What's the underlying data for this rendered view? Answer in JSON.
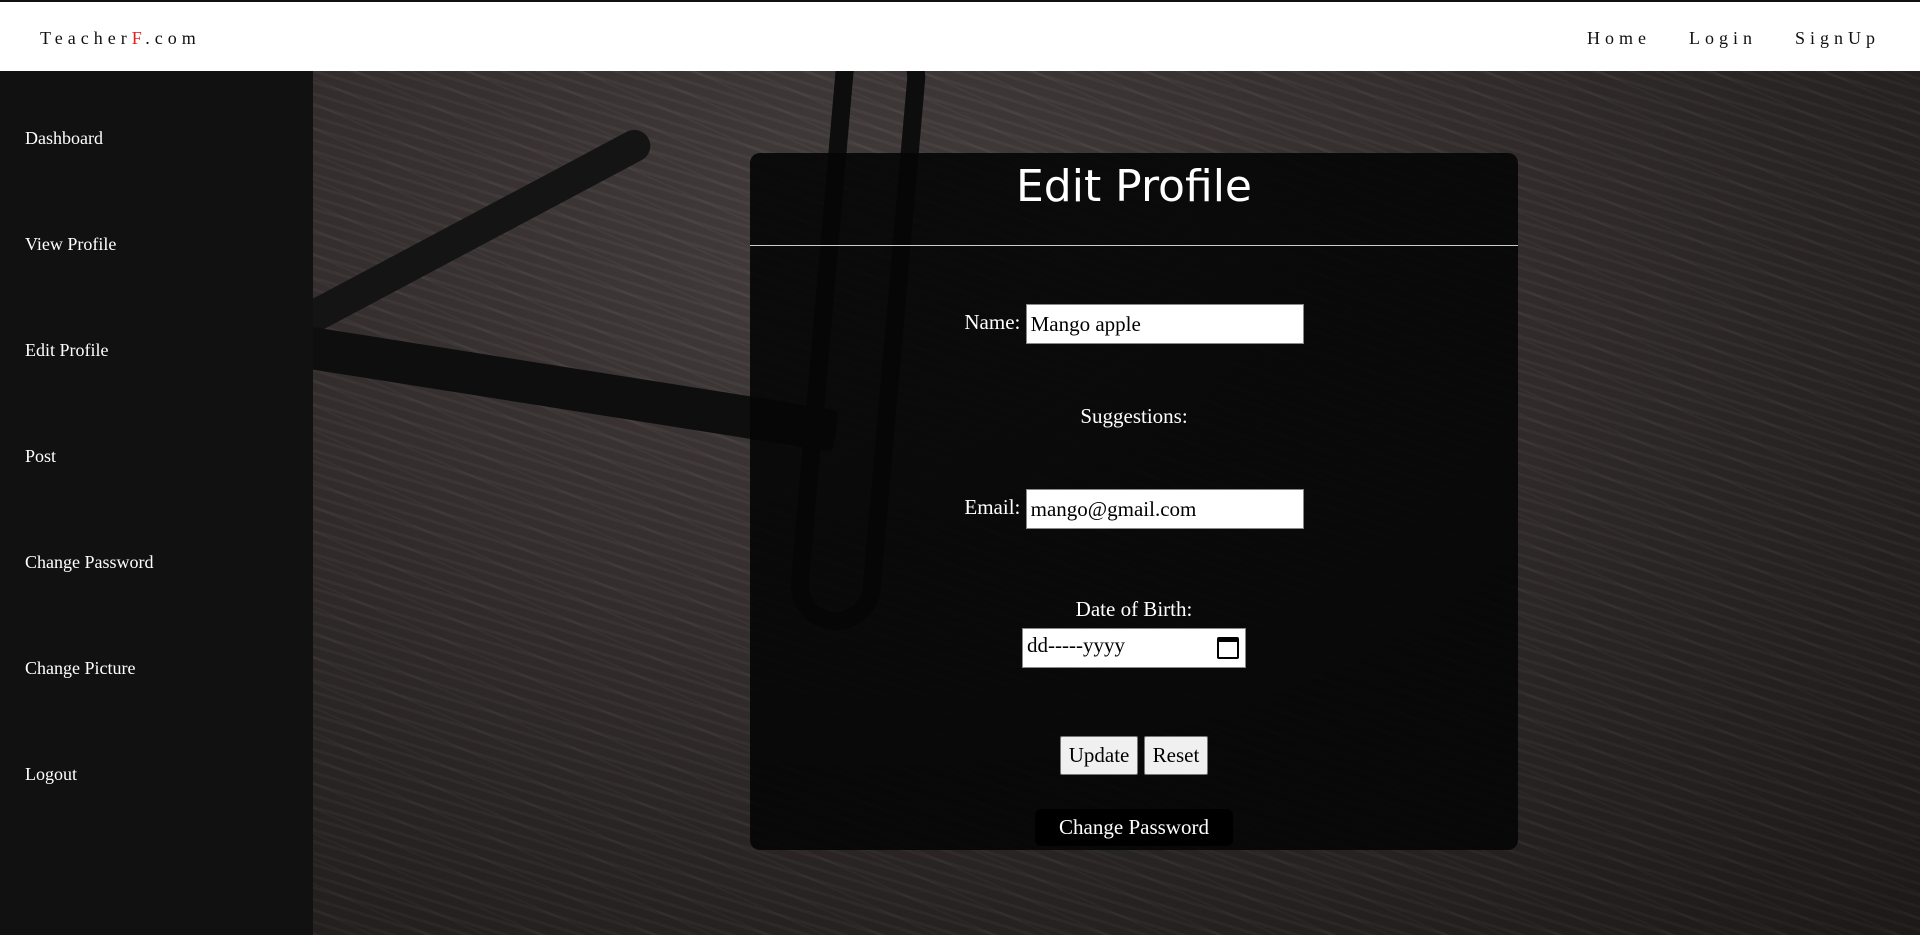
{
  "brand": {
    "prefix": "Teacher",
    "accent": "F",
    "suffix": ".com"
  },
  "topnav": {
    "home": "Home",
    "login": "Login",
    "signup": "SignUp"
  },
  "sidebar": {
    "items": [
      {
        "label": "Dashboard"
      },
      {
        "label": "View Profile"
      },
      {
        "label": "Edit Profile"
      },
      {
        "label": "Post"
      },
      {
        "label": "Change Password"
      },
      {
        "label": "Change Picture"
      },
      {
        "label": "Logout"
      }
    ]
  },
  "form": {
    "title": "Edit Profile",
    "name_label": "Name:",
    "name_value": "Mango apple",
    "suggestions_label": "Suggestions:",
    "email_label": "Email:",
    "email_value": "mango@gmail.com",
    "dob_label": "Date of Birth:",
    "dob_placeholder": "dd-----yyyy",
    "update_button": "Update",
    "reset_button": "Reset",
    "change_password_link": "Change Password"
  },
  "colors": {
    "brand_accent": "#e02020",
    "sidebar_bg": "#111111",
    "card_bg": "#060606"
  }
}
